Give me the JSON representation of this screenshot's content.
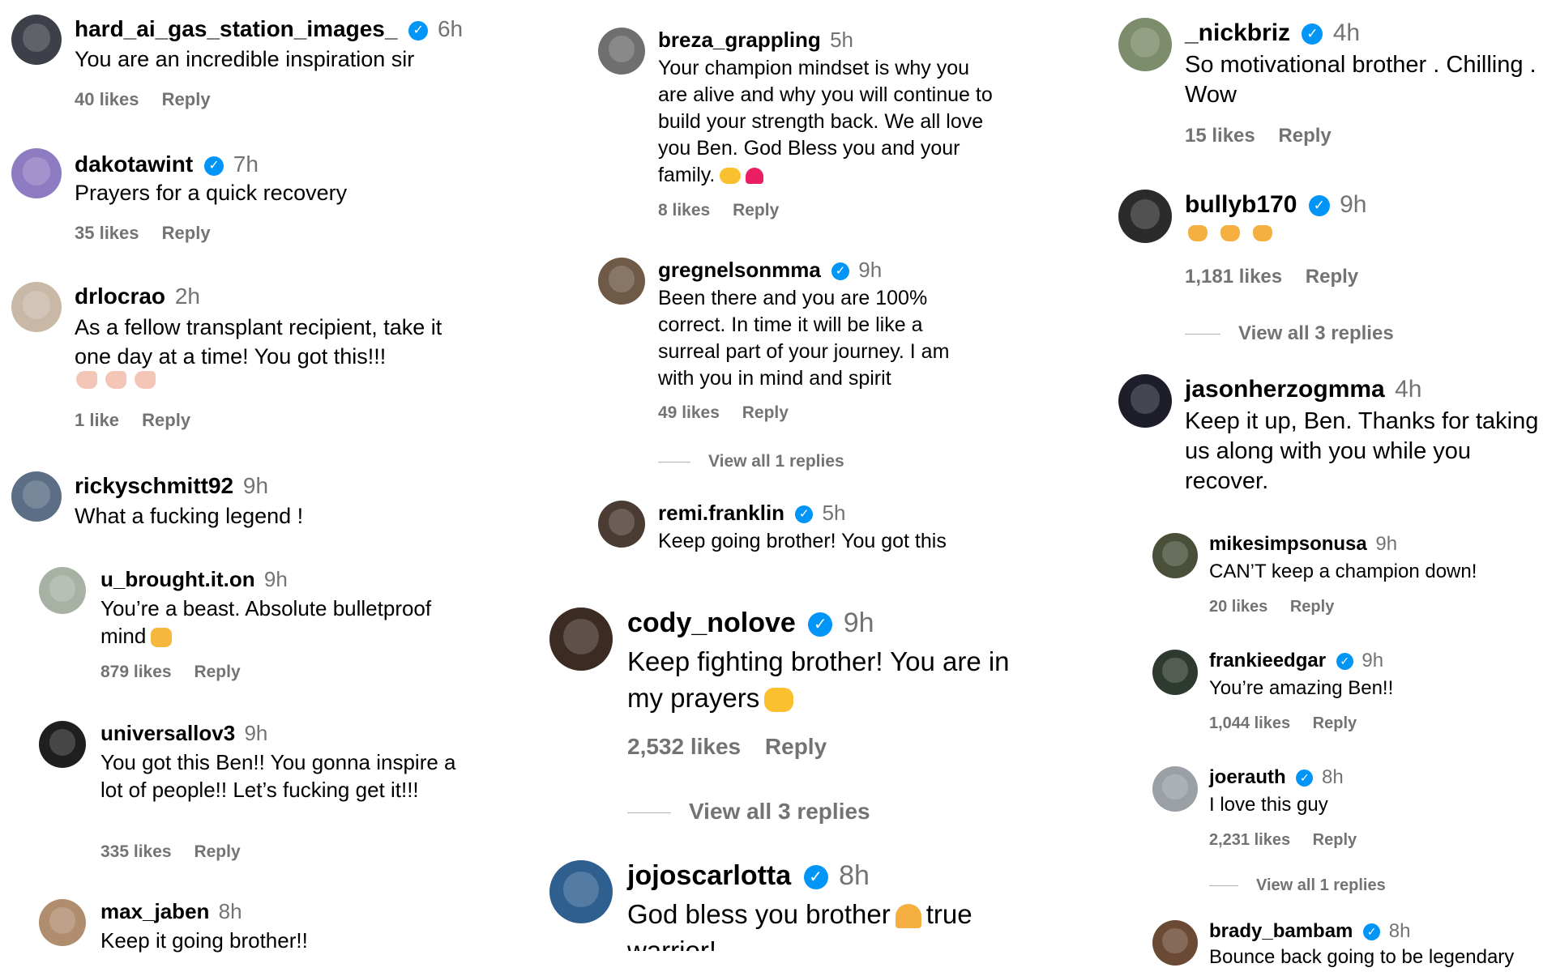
{
  "col1": {
    "c1": {
      "user": "hard_ai_gas_station_images_",
      "time": "6h",
      "text": "You are an incredible inspiration sir",
      "likes": "40 likes",
      "reply": "Reply"
    },
    "c2": {
      "user": "dakotawint",
      "time": "7h",
      "text": "Prayers for a quick recovery",
      "likes": "35 likes",
      "reply": "Reply"
    },
    "c3": {
      "user": "drlocrao",
      "time": "2h",
      "text": "As a fellow transplant recipient, take it one day at a time! You got this!!!",
      "likes": "1 like",
      "reply": "Reply"
    },
    "c4": {
      "user": "rickyschmitt92",
      "time": "9h",
      "text": "What a fucking legend !"
    },
    "c5": {
      "user": "u_brought.it.on",
      "time": "9h",
      "text": "You’re a beast. Absolute bulletproof mind",
      "likes": "879 likes",
      "reply": "Reply"
    },
    "c6": {
      "user": "universallov3",
      "time": "9h",
      "text": "You got this Ben!! You gonna inspire a lot of people!! Let’s fucking get it!!!",
      "likes": "335 likes",
      "reply": "Reply"
    },
    "c7": {
      "user": "max_jaben",
      "time": "8h",
      "text": "Keep it going brother!!"
    }
  },
  "col2": {
    "c1": {
      "user": "breza_grappling",
      "time": "5h",
      "text": "Your champion mindset is why you are alive and why you will continue to build your strength back. We all love you Ben. God Bless you and your family.",
      "likes": "8 likes",
      "reply": "Reply"
    },
    "c2": {
      "user": "gregnelsonmma",
      "time": "9h",
      "text": "Been there and you are 100% correct. In time it will be like a surreal part of your journey. I am with you in mind and spirit",
      "likes": "49 likes",
      "reply": "Reply",
      "view_replies": "View all 1 replies"
    },
    "c3": {
      "user": "remi.franklin",
      "time": "5h",
      "text": "Keep going brother! You got this"
    },
    "c4": {
      "user": "cody_nolove",
      "time": "9h",
      "text": "Keep fighting brother! You are in my prayers",
      "likes": "2,532 likes",
      "reply": "Reply",
      "view_replies": "View all 3 replies"
    },
    "c5": {
      "user": "jojoscarlotta",
      "time": "8h",
      "text_a": "God bless you brother",
      "text_b": "true",
      "text_c": "warrior!"
    }
  },
  "col3": {
    "c1": {
      "user": "_nickbriz",
      "time": "4h",
      "text": "So motivational brother . Chilling . Wow",
      "likes": "15 likes",
      "reply": "Reply"
    },
    "c2": {
      "user": "bullyb170",
      "time": "9h",
      "likes": "1,181 likes",
      "reply": "Reply",
      "view_replies": "View all 3 replies"
    },
    "c3": {
      "user": "jasonherzogmma",
      "time": "4h",
      "text": "Keep it up, Ben. Thanks for taking us along with you while you recover."
    },
    "c4": {
      "user": "mikesimpsonusa",
      "time": "9h",
      "text": "CAN’T keep a champion down!",
      "likes": "20 likes",
      "reply": "Reply"
    },
    "c5": {
      "user": "frankieedgar",
      "time": "9h",
      "text": "You’re amazing Ben!!",
      "likes": "1,044 likes",
      "reply": "Reply"
    },
    "c6": {
      "user": "joerauth",
      "time": "8h",
      "text": "I love this guy",
      "likes": "2,231 likes",
      "reply": "Reply",
      "view_replies": "View all 1 replies"
    },
    "c7": {
      "user": "brady_bambam",
      "time": "8h",
      "text": "Bounce back going to be legendary"
    }
  },
  "verified_badge": "✓",
  "colors": {
    "text": "#000000",
    "secondary": "#737373",
    "verified": "#0095f6",
    "divider": "#b5b5b5"
  }
}
